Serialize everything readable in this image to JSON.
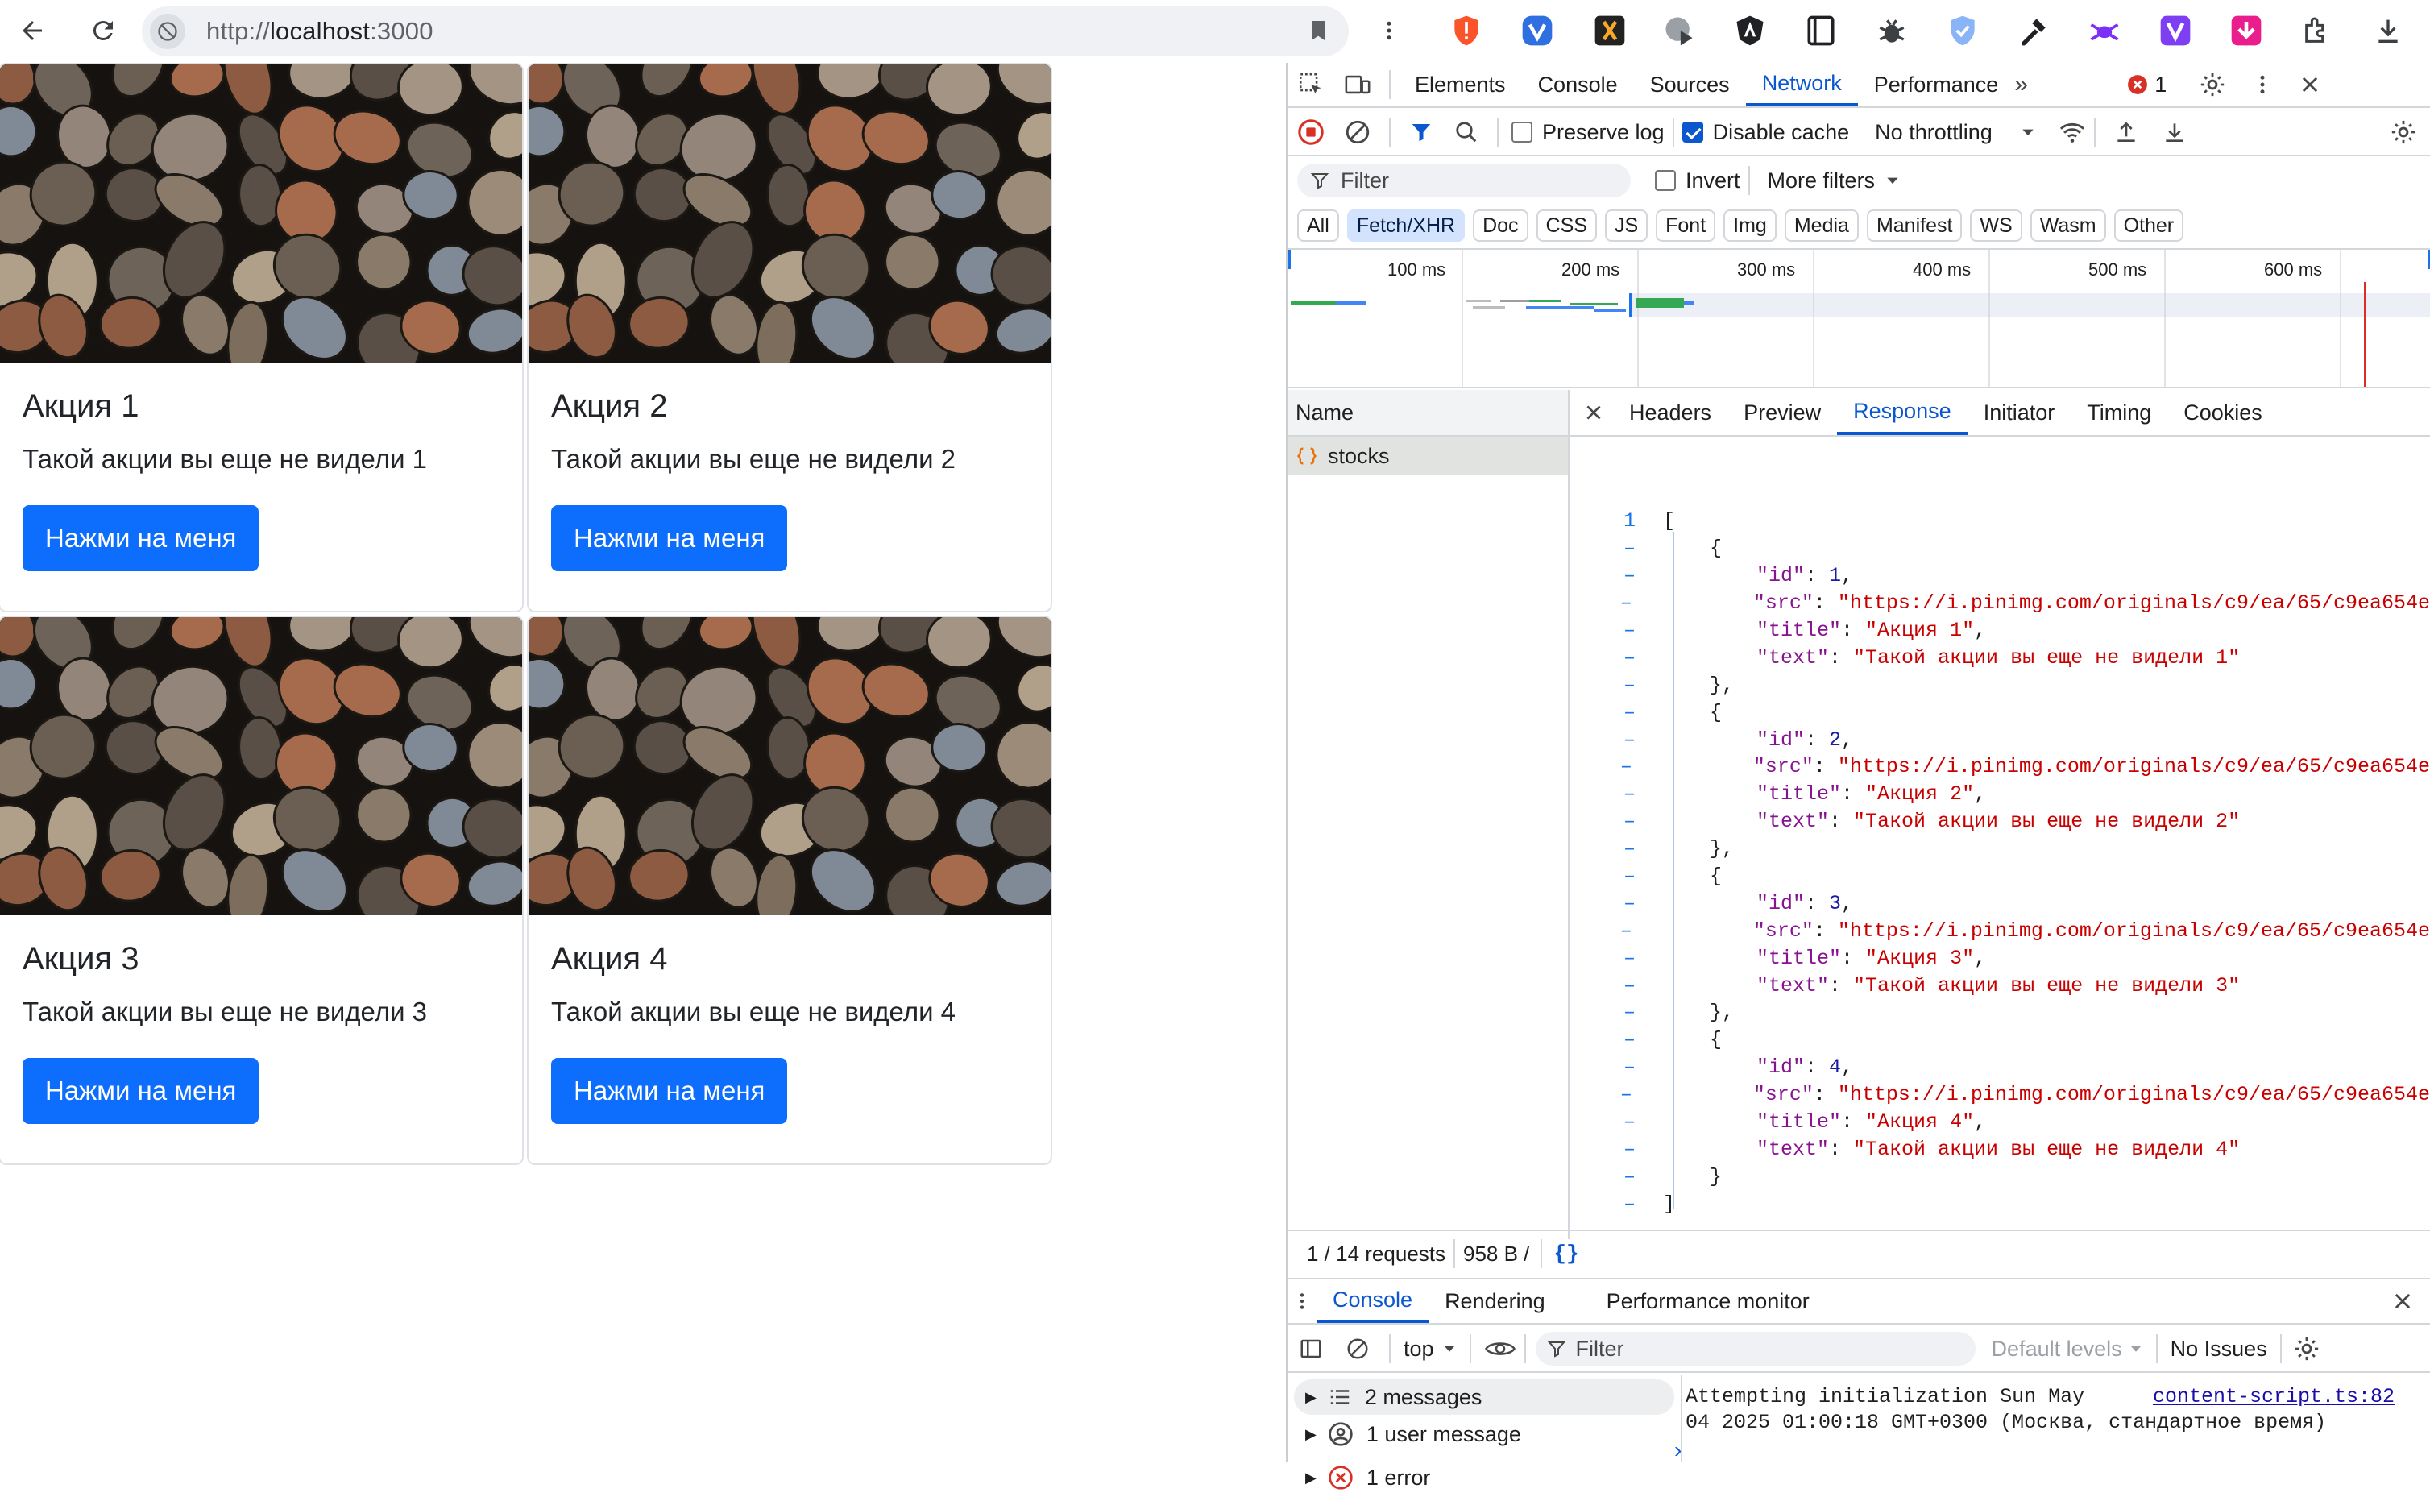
{
  "browser": {
    "url_prefix": "http://",
    "url_host": "localhost",
    "url_port": ":3000"
  },
  "cards": [
    {
      "title": "Акция 1",
      "text": "Такой акции вы еще не видели 1",
      "button": "Нажми на меня"
    },
    {
      "title": "Акция 2",
      "text": "Такой акции вы еще не видели 2",
      "button": "Нажми на меня"
    },
    {
      "title": "Акция 3",
      "text": "Такой акции вы еще не видели 3",
      "button": "Нажми на меня"
    },
    {
      "title": "Акция 4",
      "text": "Такой акции вы еще не видели 4",
      "button": "Нажми на меня"
    }
  ],
  "devtools": {
    "tabs": [
      "Elements",
      "Console",
      "Sources",
      "Network",
      "Performance"
    ],
    "active_tab": "Network",
    "error_count": "1",
    "toolbar": {
      "preserve_log": "Preserve log",
      "disable_cache": "Disable cache",
      "throttling": "No throttling"
    },
    "filter": {
      "placeholder": "Filter",
      "invert": "Invert",
      "more_filters": "More filters"
    },
    "type_chips": [
      "All",
      "Fetch/XHR",
      "Doc",
      "CSS",
      "JS",
      "Font",
      "Img",
      "Media",
      "Manifest",
      "WS",
      "Wasm",
      "Other"
    ],
    "active_chip": "Fetch/XHR",
    "timeline_ticks": [
      "100 ms",
      "200 ms",
      "300 ms",
      "400 ms",
      "500 ms",
      "600 ms"
    ],
    "name_header": "Name",
    "request_name": "stocks",
    "detail_tabs": [
      "Headers",
      "Preview",
      "Response",
      "Initiator",
      "Timing",
      "Cookies"
    ],
    "active_detail_tab": "Response",
    "response_lines": [
      {
        "num": "1",
        "indent": 0,
        "text": "["
      },
      {
        "num": "–",
        "indent": 1,
        "text": "{"
      },
      {
        "num": "–",
        "indent": 2,
        "key": "\"id\"",
        "sep": ": ",
        "num_val": "1",
        "end": ","
      },
      {
        "num": "–",
        "indent": 2,
        "key": "\"src\"",
        "sep": ": ",
        "str_val": "\"https://i.pinimg.com/originals/c9/ea/65/c9ea654e",
        "end": ""
      },
      {
        "num": "–",
        "indent": 2,
        "key": "\"title\"",
        "sep": ": ",
        "str_val": "\"Акция 1\"",
        "end": ","
      },
      {
        "num": "–",
        "indent": 2,
        "key": "\"text\"",
        "sep": ": ",
        "str_val": "\"Такой акции вы еще не видели 1\"",
        "end": ""
      },
      {
        "num": "–",
        "indent": 1,
        "text": "},"
      },
      {
        "num": "–",
        "indent": 1,
        "text": "{"
      },
      {
        "num": "–",
        "indent": 2,
        "key": "\"id\"",
        "sep": ": ",
        "num_val": "2",
        "end": ","
      },
      {
        "num": "–",
        "indent": 2,
        "key": "\"src\"",
        "sep": ": ",
        "str_val": "\"https://i.pinimg.com/originals/c9/ea/65/c9ea654e",
        "end": ""
      },
      {
        "num": "–",
        "indent": 2,
        "key": "\"title\"",
        "sep": ": ",
        "str_val": "\"Акция 2\"",
        "end": ","
      },
      {
        "num": "–",
        "indent": 2,
        "key": "\"text\"",
        "sep": ": ",
        "str_val": "\"Такой акции вы еще не видели 2\"",
        "end": ""
      },
      {
        "num": "–",
        "indent": 1,
        "text": "},"
      },
      {
        "num": "–",
        "indent": 1,
        "text": "{"
      },
      {
        "num": "–",
        "indent": 2,
        "key": "\"id\"",
        "sep": ": ",
        "num_val": "3",
        "end": ","
      },
      {
        "num": "–",
        "indent": 2,
        "key": "\"src\"",
        "sep": ": ",
        "str_val": "\"https://i.pinimg.com/originals/c9/ea/65/c9ea654e",
        "end": ""
      },
      {
        "num": "–",
        "indent": 2,
        "key": "\"title\"",
        "sep": ": ",
        "str_val": "\"Акция 3\"",
        "end": ","
      },
      {
        "num": "–",
        "indent": 2,
        "key": "\"text\"",
        "sep": ": ",
        "str_val": "\"Такой акции вы еще не видели 3\"",
        "end": ""
      },
      {
        "num": "–",
        "indent": 1,
        "text": "},"
      },
      {
        "num": "–",
        "indent": 1,
        "text": "{"
      },
      {
        "num": "–",
        "indent": 2,
        "key": "\"id\"",
        "sep": ": ",
        "num_val": "4",
        "end": ","
      },
      {
        "num": "–",
        "indent": 2,
        "key": "\"src\"",
        "sep": ": ",
        "str_val": "\"https://i.pinimg.com/originals/c9/ea/65/c9ea654e",
        "end": ""
      },
      {
        "num": "–",
        "indent": 2,
        "key": "\"title\"",
        "sep": ": ",
        "str_val": "\"Акция 4\"",
        "end": ","
      },
      {
        "num": "–",
        "indent": 2,
        "key": "\"text\"",
        "sep": ": ",
        "str_val": "\"Такой акции вы еще не видели 4\"",
        "end": ""
      },
      {
        "num": "–",
        "indent": 1,
        "text": "}"
      },
      {
        "num": "–",
        "indent": 0,
        "text": "]"
      }
    ],
    "status": {
      "requests": "1 / 14 requests",
      "size": "958 B /"
    },
    "drawer": {
      "tabs": [
        "Console",
        "Rendering",
        "Performance monitor"
      ],
      "active_tab": "Console",
      "context": "top",
      "filter_placeholder": "Filter",
      "levels": "Default levels",
      "issues": "No Issues",
      "sidebar": [
        {
          "icon": "list-icon",
          "label": "2 messages"
        },
        {
          "icon": "user-icon",
          "label": "1 user message"
        },
        {
          "icon": "error-icon",
          "label": "1 error"
        }
      ],
      "message": "Attempting initialization Sun May 04 2025 01:00:18 GMT+0300 (Москва, стандартное время)",
      "message_line1": "Attempting initialization Sun May",
      "message_line2": "04 2025 01:00:18 GMT+0300 (Москва, стандартное время)",
      "source_link": "content-script.ts:82"
    }
  },
  "colors": {
    "primary_button": "#0d6efd",
    "devtools_accent": "#0b57d0",
    "error": "#d93025"
  }
}
